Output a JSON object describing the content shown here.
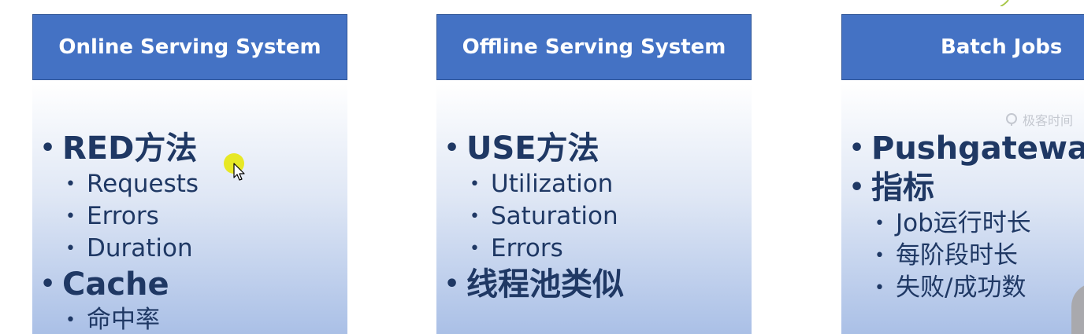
{
  "panels": [
    {
      "header": "Online Serving System",
      "items": [
        {
          "level": 1,
          "text": "RED方法"
        },
        {
          "level": 2,
          "text": "Requests"
        },
        {
          "level": 2,
          "text": "Errors"
        },
        {
          "level": 2,
          "text": "Duration"
        },
        {
          "level": 1,
          "text": "Cache"
        },
        {
          "level": 2,
          "text": "命中率"
        }
      ]
    },
    {
      "header": "Offline Serving System",
      "items": [
        {
          "level": 1,
          "text": "USE方法"
        },
        {
          "level": 2,
          "text": "Utilization"
        },
        {
          "level": 2,
          "text": "Saturation"
        },
        {
          "level": 2,
          "text": "Errors"
        },
        {
          "level": 1,
          "text": "线程池类似"
        }
      ]
    },
    {
      "header": "Batch Jobs",
      "items": [
        {
          "level": 1,
          "text": "Pushgateway"
        },
        {
          "level": 1,
          "text": "指标"
        },
        {
          "level": 2,
          "text": "Job运行时长"
        },
        {
          "level": 2,
          "text": "每阶段时长"
        },
        {
          "level": 2,
          "text": "失败/成功数"
        }
      ]
    }
  ],
  "bullet": "•",
  "watermark": {
    "text": "极客时间",
    "icon": "geektime-logo-icon"
  },
  "colors": {
    "header_bg": "#4472c4",
    "header_text": "#ffffff",
    "body_text": "#1f3864",
    "cursor_highlight": "#e6e600"
  }
}
